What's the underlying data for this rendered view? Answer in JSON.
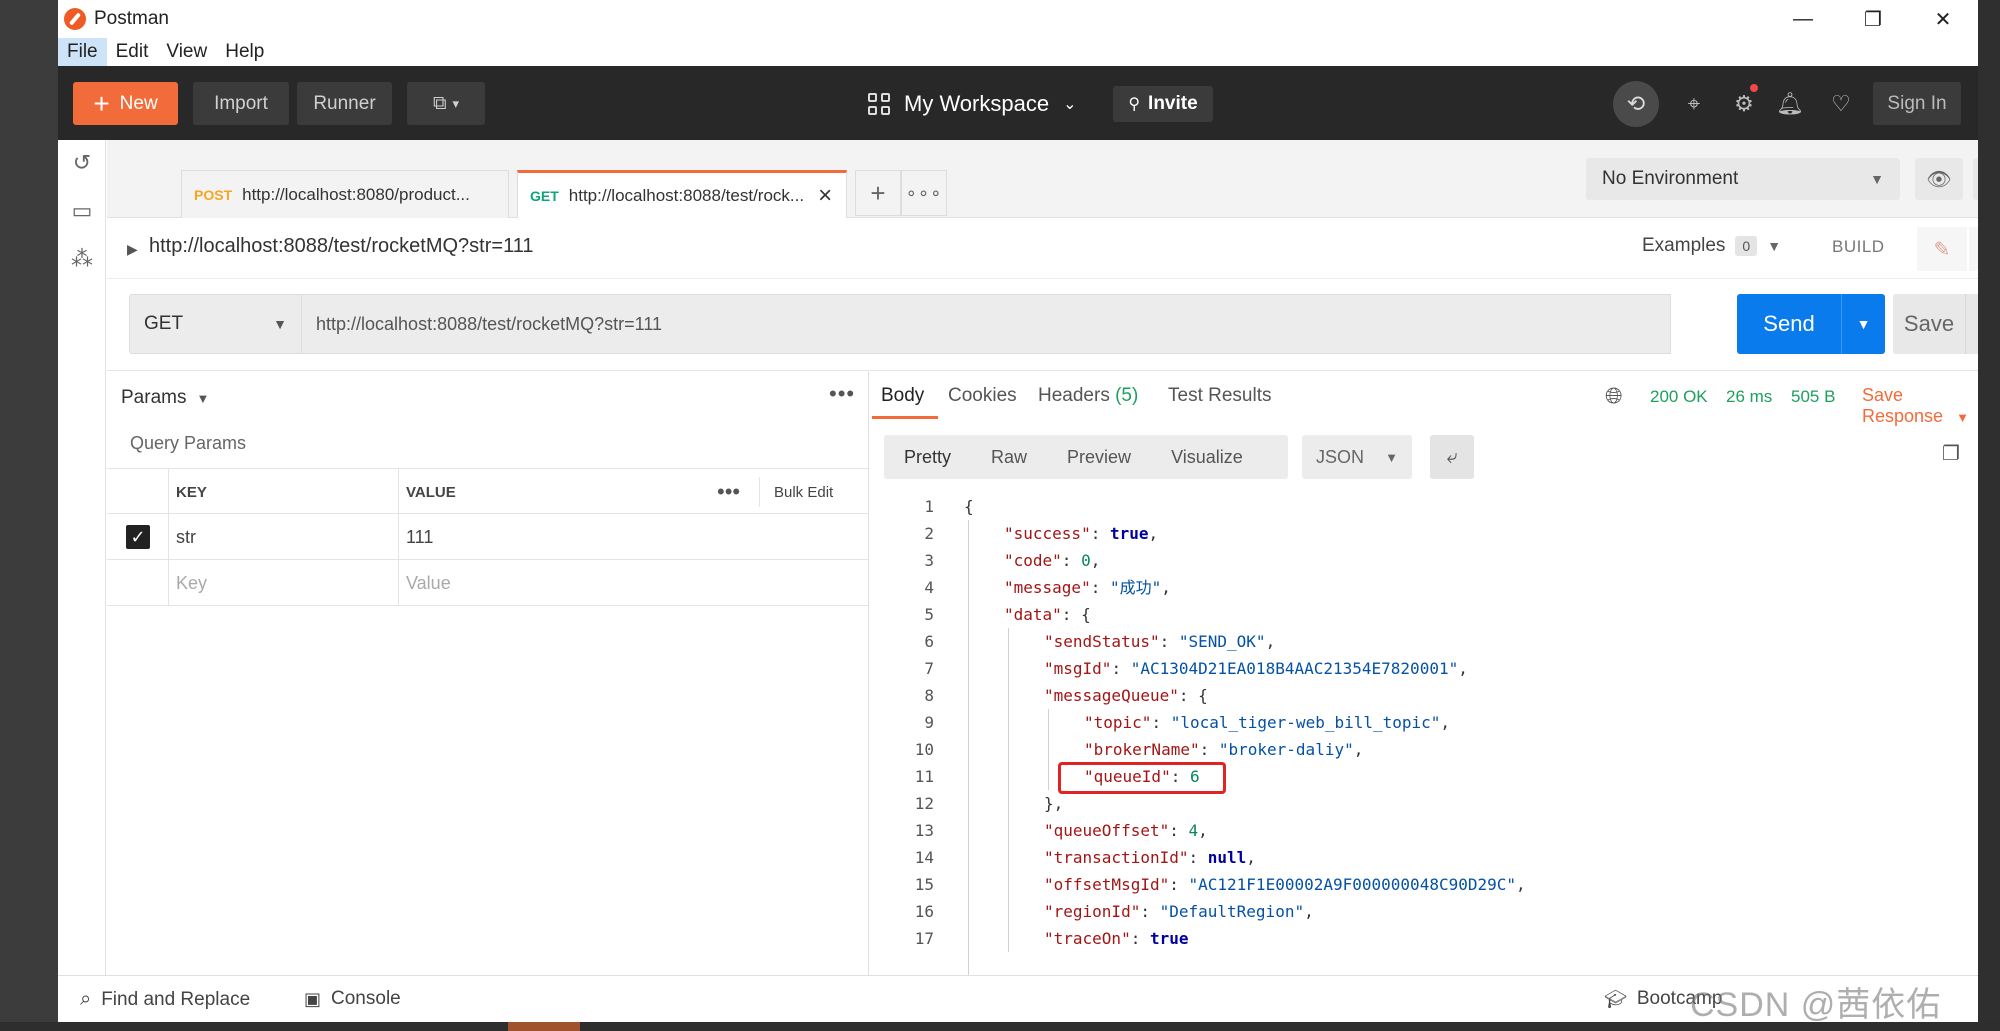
{
  "app": {
    "title": "Postman"
  },
  "menu": [
    "File",
    "Edit",
    "View",
    "Help"
  ],
  "header": {
    "new_label": "New",
    "import_label": "Import",
    "runner_label": "Runner",
    "workspace_label": "My Workspace",
    "invite_label": "Invite",
    "signin_label": "Sign In"
  },
  "tabs": [
    {
      "method": "POST",
      "url": "http://localhost:8080/product..."
    },
    {
      "method": "GET",
      "url": "http://localhost:8088/test/rock..."
    }
  ],
  "environment": {
    "selected": "No Environment"
  },
  "request": {
    "name": "http://localhost:8088/test/rocketMQ?str=111",
    "examples_label": "Examples",
    "examples_count": "0",
    "build_label": "BUILD",
    "method": "GET",
    "url": "http://localhost:8088/test/rocketMQ?str=111",
    "send_label": "Send",
    "save_label": "Save"
  },
  "params": {
    "header_label": "Params",
    "section_label": "Query Params",
    "col_key": "KEY",
    "col_value": "VALUE",
    "bulk_edit_label": "Bulk Edit",
    "rows": [
      {
        "key": "str",
        "value": "111"
      }
    ],
    "key_placeholder": "Key",
    "value_placeholder": "Value"
  },
  "response": {
    "tabs": [
      "Body",
      "Cookies",
      "Headers",
      "Test Results"
    ],
    "headers_count": "(5)",
    "status": "200 OK",
    "time": "26 ms",
    "size": "505 B",
    "save_response_label": "Save Response",
    "formats": [
      "Pretty",
      "Raw",
      "Preview",
      "Visualize"
    ],
    "content_type": "JSON",
    "lines": [
      {
        "n": "1",
        "indent": 0,
        "parts": [
          [
            "p",
            "{"
          ]
        ]
      },
      {
        "n": "2",
        "indent": 1,
        "parts": [
          [
            "k",
            "\"success\""
          ],
          [
            "p",
            ": "
          ],
          [
            "b",
            "true"
          ],
          [
            "p",
            ","
          ]
        ]
      },
      {
        "n": "3",
        "indent": 1,
        "parts": [
          [
            "k",
            "\"code\""
          ],
          [
            "p",
            ": "
          ],
          [
            "n",
            "0"
          ],
          [
            "p",
            ","
          ]
        ]
      },
      {
        "n": "4",
        "indent": 1,
        "parts": [
          [
            "k",
            "\"message\""
          ],
          [
            "p",
            ": "
          ],
          [
            "s",
            "\"成功\""
          ],
          [
            "p",
            ","
          ]
        ]
      },
      {
        "n": "5",
        "indent": 1,
        "parts": [
          [
            "k",
            "\"data\""
          ],
          [
            "p",
            ": {"
          ]
        ]
      },
      {
        "n": "6",
        "indent": 2,
        "parts": [
          [
            "k",
            "\"sendStatus\""
          ],
          [
            "p",
            ": "
          ],
          [
            "s",
            "\"SEND_OK\""
          ],
          [
            "p",
            ","
          ]
        ]
      },
      {
        "n": "7",
        "indent": 2,
        "parts": [
          [
            "k",
            "\"msgId\""
          ],
          [
            "p",
            ": "
          ],
          [
            "s",
            "\"AC1304D21EA018B4AAC21354E7820001\""
          ],
          [
            "p",
            ","
          ]
        ]
      },
      {
        "n": "8",
        "indent": 2,
        "parts": [
          [
            "k",
            "\"messageQueue\""
          ],
          [
            "p",
            ": {"
          ]
        ]
      },
      {
        "n": "9",
        "indent": 3,
        "parts": [
          [
            "k",
            "\"topic\""
          ],
          [
            "p",
            ": "
          ],
          [
            "s",
            "\"local_tiger-web_bill_topic\""
          ],
          [
            "p",
            ","
          ]
        ]
      },
      {
        "n": "10",
        "indent": 3,
        "parts": [
          [
            "k",
            "\"brokerName\""
          ],
          [
            "p",
            ": "
          ],
          [
            "s",
            "\"broker-daliy\""
          ],
          [
            "p",
            ","
          ]
        ]
      },
      {
        "n": "11",
        "indent": 3,
        "parts": [
          [
            "k",
            "\"queueId\""
          ],
          [
            "p",
            ": "
          ],
          [
            "n",
            "6"
          ]
        ]
      },
      {
        "n": "12",
        "indent": 2,
        "parts": [
          [
            "p",
            "},"
          ]
        ]
      },
      {
        "n": "13",
        "indent": 2,
        "parts": [
          [
            "k",
            "\"queueOffset\""
          ],
          [
            "p",
            ": "
          ],
          [
            "n",
            "4"
          ],
          [
            "p",
            ","
          ]
        ]
      },
      {
        "n": "14",
        "indent": 2,
        "parts": [
          [
            "k",
            "\"transactionId\""
          ],
          [
            "p",
            ": "
          ],
          [
            "b",
            "null"
          ],
          [
            "p",
            ","
          ]
        ]
      },
      {
        "n": "15",
        "indent": 2,
        "parts": [
          [
            "k",
            "\"offsetMsgId\""
          ],
          [
            "p",
            ": "
          ],
          [
            "s",
            "\"AC121F1E00002A9F000000048C90D29C\""
          ],
          [
            "p",
            ","
          ]
        ]
      },
      {
        "n": "16",
        "indent": 2,
        "parts": [
          [
            "k",
            "\"regionId\""
          ],
          [
            "p",
            ": "
          ],
          [
            "s",
            "\"DefaultRegion\""
          ],
          [
            "p",
            ","
          ]
        ]
      },
      {
        "n": "17",
        "indent": 2,
        "parts": [
          [
            "k",
            "\"traceOn\""
          ],
          [
            "p",
            ": "
          ],
          [
            "b",
            "true"
          ]
        ]
      }
    ]
  },
  "footer": {
    "find_replace_label": "Find and Replace",
    "console_label": "Console",
    "bootcamp_label": "Bootcamp",
    "watermark": "CSDN @茜依佑"
  }
}
